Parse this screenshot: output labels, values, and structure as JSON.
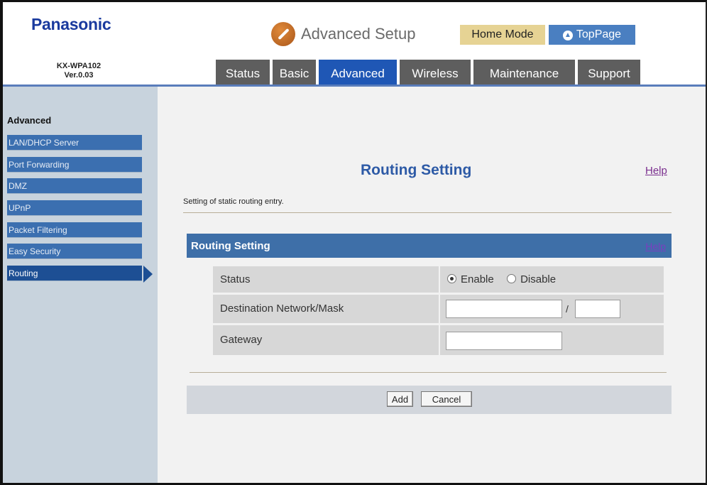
{
  "header": {
    "brand": "Panasonic",
    "model_line1": "KX-WPA102",
    "model_line2": "Ver.0.03",
    "title": "Advanced Setup",
    "home_mode": "Home Mode",
    "top_page": "TopPage"
  },
  "tabs": [
    {
      "label": "Status",
      "active": false
    },
    {
      "label": "Basic",
      "active": false
    },
    {
      "label": "Advanced",
      "active": true
    },
    {
      "label": "Wireless",
      "active": false
    },
    {
      "label": "Maintenance",
      "active": false
    },
    {
      "label": "Support",
      "active": false
    }
  ],
  "sidebar": {
    "heading": "Advanced",
    "items": [
      {
        "label": "LAN/DHCP Server",
        "active": false
      },
      {
        "label": "Port Forwarding",
        "active": false
      },
      {
        "label": "DMZ",
        "active": false
      },
      {
        "label": "UPnP",
        "active": false
      },
      {
        "label": "Packet Filtering",
        "active": false
      },
      {
        "label": "Easy Security",
        "active": false
      },
      {
        "label": "Routing",
        "active": true
      }
    ]
  },
  "main": {
    "title": "Routing Setting",
    "help": "Help",
    "description": "Setting of static routing entry.",
    "section": {
      "title": "Routing Setting",
      "help": "Help"
    },
    "form": {
      "status_label": "Status",
      "enable_label": "Enable",
      "disable_label": "Disable",
      "status_value": "Enable",
      "destination_label": "Destination Network/Mask",
      "destination_value": "",
      "mask_separator": "/",
      "mask_value": "",
      "gateway_label": "Gateway",
      "gateway_value": ""
    },
    "buttons": {
      "add": "Add",
      "cancel": "Cancel"
    }
  },
  "colors": {
    "brand": "#1a3a9e",
    "active_tab": "#1f57b5",
    "section_bar": "#3e6fa8",
    "sidebar_item": "#3b6fb0"
  }
}
